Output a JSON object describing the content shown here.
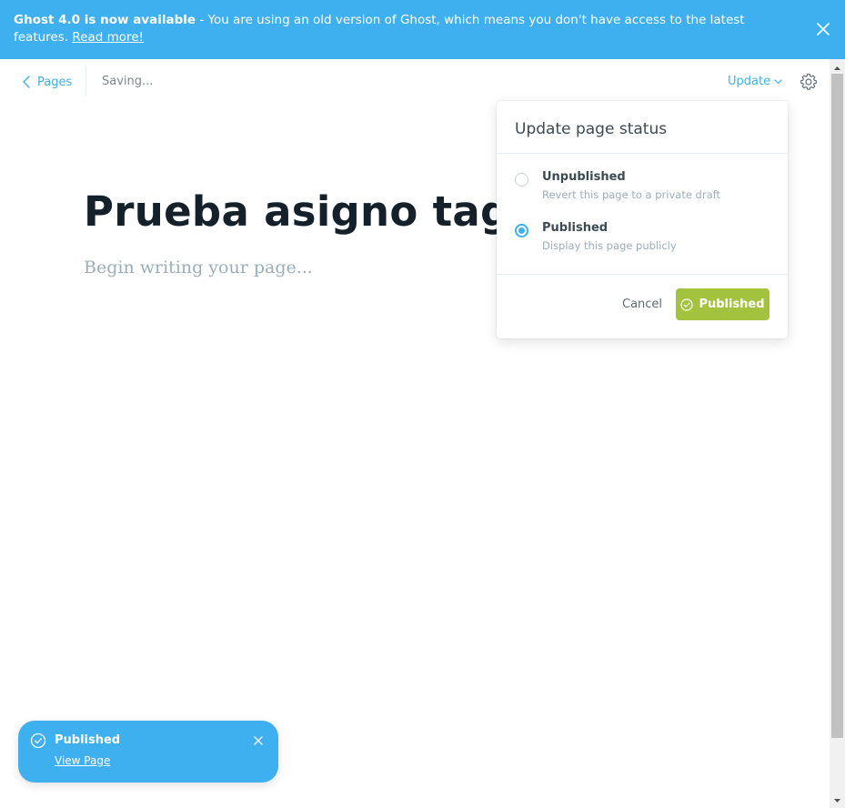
{
  "banner": {
    "headline": "Ghost 4.0 is now available",
    "message": " - You are using an old version of Ghost, which means you don't have access to the latest features. ",
    "link_text": "Read more!",
    "close_icon": "close-icon"
  },
  "header": {
    "back_label": "Pages",
    "save_status": "Saving...",
    "update_label": "Update",
    "settings_icon": "gear-icon"
  },
  "editor": {
    "title": "Prueba asigno tag a pagina",
    "body_placeholder": "Begin writing your page..."
  },
  "publish_menu": {
    "title": "Update page status",
    "options": [
      {
        "label": "Unpublished",
        "description": "Revert this page to a private draft",
        "selected": false
      },
      {
        "label": "Published",
        "description": "Display this page publicly",
        "selected": true
      }
    ],
    "cancel_label": "Cancel",
    "confirm_label": "Published"
  },
  "toast": {
    "title": "Published",
    "link_text": "View Page"
  },
  "colors": {
    "accent": "#3eb0ef",
    "publish_green": "#a3c23e",
    "text_dark": "#15212a",
    "muted": "#9baeb8"
  }
}
